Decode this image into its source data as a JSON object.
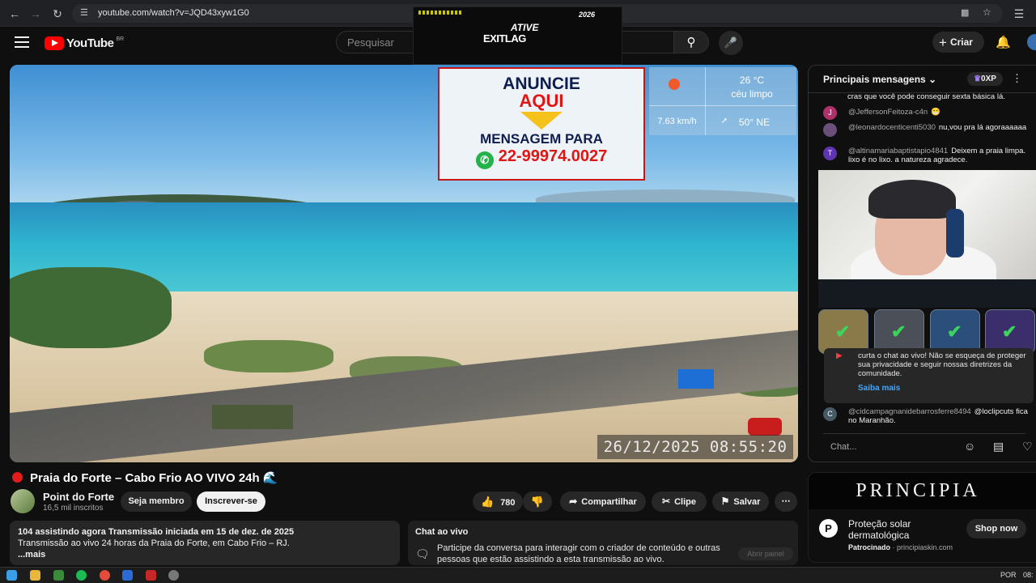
{
  "browser": {
    "url": "youtube.com/watch?v=JQD43xyw1G0",
    "back_icon": "arrow-left-icon",
    "forward_icon": "arrow-right-icon",
    "reload_icon": "reload-icon"
  },
  "header": {
    "logo_text": "YouTube",
    "country_code": "BR",
    "search_placeholder": "Pesquisar",
    "create_label": "Criar"
  },
  "ad_overlay": {
    "top_text": "ATIVE",
    "brand": "EXITLAG",
    "corner_text": "2026"
  },
  "video": {
    "ad_line1": "ANUNCIE",
    "ad_line2": "AQUI",
    "ad_line3": "MENSAGEM PARA",
    "ad_phone": "22-99974.0027",
    "weather_temp": "26 °C",
    "weather_desc": "céu limpo",
    "weather_wind": "7.63 km/h",
    "weather_dir": "50° NE",
    "timestamp": "26/12/2025 08:55:20"
  },
  "meta": {
    "title": "Praia do Forte – Cabo Frio AO VIVO 24h",
    "channel_name": "Point do Forte",
    "subscribers": "16,5 mil inscritos",
    "member_label": "Seja membro",
    "subscribe_label": "Inscrever-se",
    "likes": "780",
    "share_label": "Compartilhar",
    "clip_label": "Clipe",
    "save_label": "Salvar"
  },
  "description": {
    "stats": "104 assistindo agora  Transmissão iniciada em 15 de dez. de 2025",
    "text": "Transmissão ao vivo 24 horas da Praia do Forte, em Cabo Frio – RJ.",
    "more": "...mais"
  },
  "chat_info": {
    "heading": "Chat ao vivo",
    "text": "Participe da conversa para interagir com o criador de conteúdo e outras pessoas que estão assistindo a esta transmissão ao vivo.",
    "button": "Abrir painel"
  },
  "chat": {
    "header": "Principais mensagens",
    "xp_label": "0XP",
    "messages": [
      {
        "avatar": "",
        "user": "",
        "text": "cras que você pode conseguir sexta básica lá.",
        "color": "#444444"
      },
      {
        "avatar": "J",
        "user": "@JeffersonFeitoza-c4n",
        "text": "😁",
        "color": "#b0306a"
      },
      {
        "avatar": "",
        "user": "@leonardocenticenti5030",
        "text": "nu,vou pra lá agoraaaaaa",
        "color": "#6a4f7a"
      },
      {
        "avatar": "T",
        "user": "@altinamariabaptistapio4841",
        "text": "Deixem a praia limpa. lixo é no lixo. a natureza agradece.",
        "color": "#5e35b1"
      },
      {
        "avatar": "C",
        "user": "@cidcampagnanidebarrosferre8494",
        "text": "@loclipcuts fica no Maranhão.",
        "color": "#455a64"
      }
    ],
    "notice_text": "curta o chat ao vivo! Não se esqueça de proteger sua privacidade e seguir nossas diretrizes da comunidade.",
    "notice_link": "Saiba mais",
    "input_placeholder": "Chat..."
  },
  "sponsor": {
    "banner": "PRINCIPIA",
    "logo_letter": "P",
    "title": "Proteção solar dermatológica",
    "label": "Patrocinado",
    "domain": "principiaskin.com",
    "button": "Shop now"
  },
  "taskbar": {
    "lang": "POR",
    "time": "08:"
  }
}
